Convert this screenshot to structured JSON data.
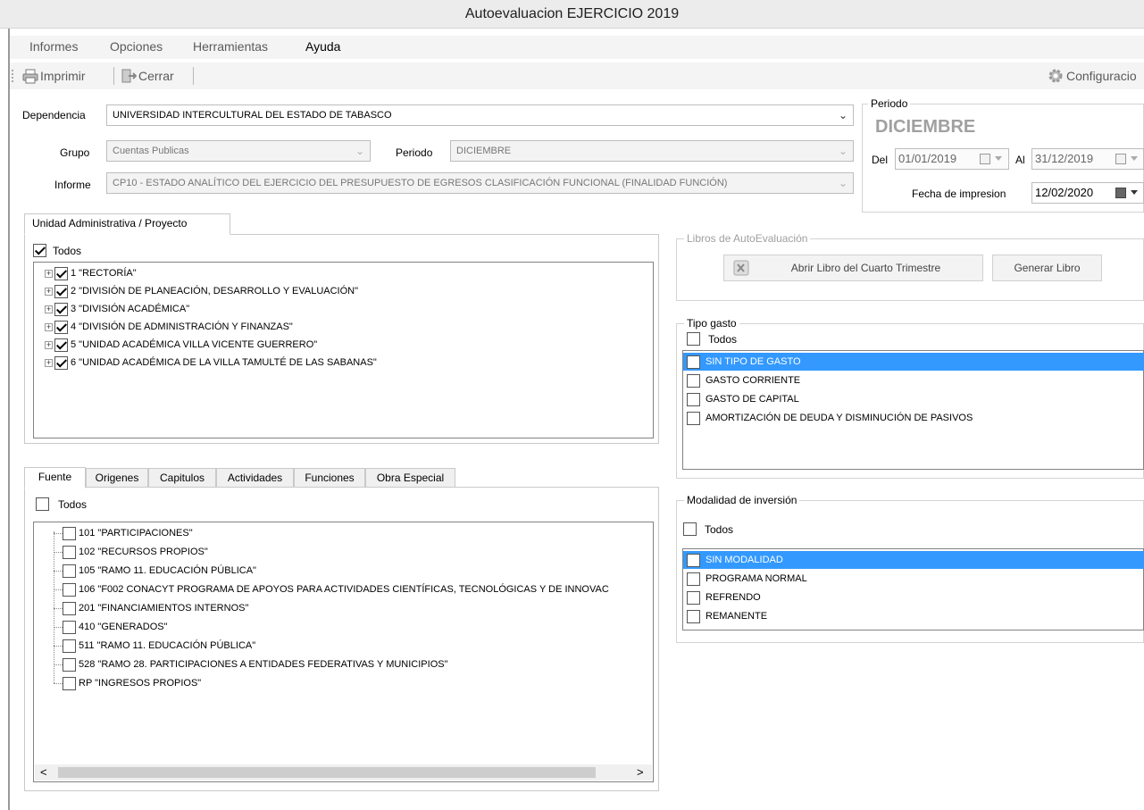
{
  "window": {
    "title": "Autoevaluacion EJERCICIO 2019"
  },
  "menu": {
    "items": [
      "Informes",
      "Opciones",
      "Herramientas",
      "Ayuda"
    ]
  },
  "toolbar": {
    "print_label": "Imprimir",
    "close_label": "Cerrar",
    "config_label": "Configuracio"
  },
  "filters": {
    "dependencia_label": "Dependencia",
    "dependencia_value": "UNIVERSIDAD INTERCULTURAL DEL ESTADO DE TABASCO",
    "grupo_label": "Grupo",
    "grupo_value": "Cuentas Publicas",
    "periodo_label": "Periodo",
    "periodo_value": "DICIEMBRE",
    "informe_label": "Informe",
    "informe_value": "CP10 - ESTADO ANALÍTICO DEL EJERCICIO DEL PRESUPUESTO DE EGRESOS CLASIFICACIÓN FUNCIONAL (FINALIDAD FUNCIÓN)"
  },
  "period_box": {
    "title": "Periodo",
    "month": "DICIEMBRE",
    "del_label": "Del",
    "del_value": "01/01/2019",
    "al_label": "Al",
    "al_value": "31/12/2019",
    "print_date_label": "Fecha de impresion",
    "print_date_value": "12/02/2020"
  },
  "unidad": {
    "tab_label": "Unidad Administrativa / Proyecto",
    "todos_label": "Todos",
    "items": [
      "1 \"RECTORÍA\"",
      "2 \"DIVISIÓN DE PLANEACIÓN, DESARROLLO Y EVALUACIÓN\"",
      "3 \"DIVISIÓN ACADÉMICA\"",
      "4 \"DIVISIÓN DE ADMINISTRACIÓN Y FINANZAS\"",
      "5 \"UNIDAD ACADÉMICA VILLA VICENTE GUERRERO\"",
      "6 \"UNIDAD ACADÉMICA DE LA VILLA TAMULTÉ DE LAS SABANAS\""
    ]
  },
  "fuente": {
    "tabs": [
      "Fuente",
      "Origenes",
      "Capitulos",
      "Actividades",
      "Funciones",
      "Obra Especial"
    ],
    "todos_label": "Todos",
    "items": [
      "101 \"PARTICIPACIONES\"",
      "102 \"RECURSOS PROPIOS\"",
      "105 \"RAMO 11. EDUCACIÓN PÚBLICA\"",
      "106 \"F002 CONACYT PROGRAMA DE APOYOS PARA ACTIVIDADES CIENTÍFICAS, TECNOLÓGICAS Y DE INNOVAC",
      "201 \"FINANCIAMIENTOS INTERNOS\"",
      "410 \"GENERADOS\"",
      "511 \"RAMO 11. EDUCACIÓN PÚBLICA\"",
      "528 \"RAMO 28. PARTICIPACIONES A ENTIDADES FEDERATIVAS Y MUNICIPIOS\"",
      "RP \"INGRESOS PROPIOS\""
    ],
    "scroll_left": "<",
    "scroll_right": ">"
  },
  "libros": {
    "title": "Libros de AutoEvaluación",
    "open_label": "Abrir Libro del Cuarto Trimestre",
    "generate_label": "Generar Libro"
  },
  "tipo_gasto": {
    "title": "Tipo gasto",
    "todos_label": "Todos",
    "items": [
      "SIN TIPO DE GASTO",
      "GASTO CORRIENTE",
      "GASTO DE CAPITAL",
      "AMORTIZACIÓN DE DEUDA Y DISMINUCIÓN DE PASIVOS"
    ]
  },
  "modalidad": {
    "title": "Modalidad de inversión",
    "todos_label": "Todos",
    "items": [
      "SIN MODALIDAD",
      "PROGRAMA NORMAL",
      "REFRENDO",
      "REMANENTE"
    ]
  },
  "colors": {
    "selection": "#3399ff",
    "titlebar": "#ececec"
  }
}
